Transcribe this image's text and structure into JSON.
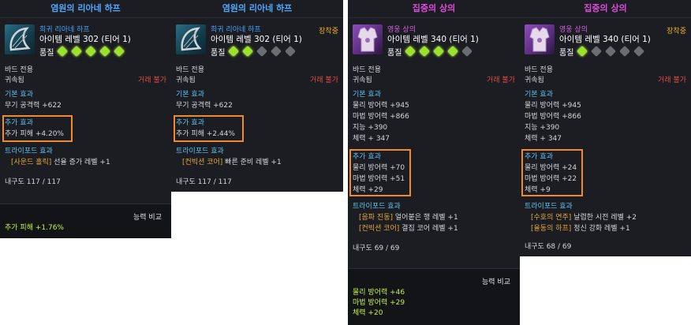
{
  "cards": [
    {
      "title": "염원의 리아네 하프",
      "grade": "희귀 리아네 하프",
      "level": "아이템 레벨 302 (티어 1)",
      "quality_label": "품질",
      "quality_stars_lit": 5,
      "quality_stars_total": 5,
      "bound_class": "바드 전용",
      "bound": "귀속됨",
      "untradable": "거래 불가",
      "base_title": "기본 효과",
      "base_stats": [
        "무기 공격력 +622"
      ],
      "extra_title": "추가 효과",
      "extra_stats": [
        "추가 피해 +4.20%"
      ],
      "tripod_title": "트라이포드 효과",
      "tripods": [
        {
          "name": "[사운드 홀릭]",
          "desc": "선율 증가 레벨 +1"
        }
      ],
      "durability": "내구도 117 / 117",
      "compare_title": "능력 비교",
      "compare_stats": [
        "추가 피해 +1.76%"
      ]
    },
    {
      "title": "염원의 리아네 하프",
      "grade": "희귀 리아네 하프",
      "equipped": "장착중",
      "level": "아이템 레벨 302 (티어 1)",
      "quality_label": "품질",
      "quality_stars_lit": 2,
      "quality_stars_total": 5,
      "bound_class": "바드 전용",
      "bound": "귀속됨",
      "untradable": "거래 불가",
      "base_title": "기본 효과",
      "base_stats": [
        "무기 공격력 +622"
      ],
      "extra_title": "추가 효과",
      "extra_stats": [
        "추가 피해 +2.44%"
      ],
      "tripod_title": "트라이포드 효과",
      "tripods": [
        {
          "name": "[컨빅션 코어]",
          "desc": "빠른 준비 레벨 +1"
        }
      ],
      "durability": "내구도 117 / 117"
    },
    {
      "title": "집중의 상의",
      "grade": "영웅 상의",
      "level": "아이템 레벨 340 (티어 1)",
      "quality_label": "품질",
      "quality_stars_lit": 4,
      "quality_stars_total": 5,
      "bound_class": "바드 전용",
      "bound": "귀속됨",
      "untradable": "거래 불가",
      "base_title": "기본 효과",
      "base_stats": [
        "물리 방어력 +945",
        "마법 방어력 +866",
        "지능 +390",
        "체력 + 347"
      ],
      "extra_title": "추가 효과",
      "extra_stats": [
        "물리 방어력 +70",
        "마법 방어력 +51",
        "체력 +29"
      ],
      "tripod_title": "트라이포드 효과",
      "tripods": [
        {
          "name": "[음파 진동]",
          "desc": "얼어붙은 행 레벨 +1"
        },
        {
          "name": "[컨빅션 코어]",
          "desc": "결집 코어 레벨 +1"
        }
      ],
      "durability": "내구도 69 / 69",
      "compare_title": "능력 비교",
      "compare_stats": [
        "물리 방어력 +46",
        "마법 방어력 +29",
        "체력 +20"
      ]
    },
    {
      "title": "집중의 상의",
      "grade": "영웅 상의",
      "equipped": "장착중",
      "level": "아이템 레벨 340 (티어 1)",
      "quality_label": "품질",
      "quality_stars_lit": 1,
      "quality_stars_total": 5,
      "bound_class": "바드 전용",
      "bound": "귀속됨",
      "untradable": "거래 불가",
      "base_title": "기본 효과",
      "base_stats": [
        "물리 방어력 +945",
        "마법 방어력 +866",
        "지능 +390",
        "체력 + 347"
      ],
      "extra_title": "추가 효과",
      "extra_stats": [
        "물리 방어력 +24",
        "마법 방어력 +22",
        "체력 +9"
      ],
      "tripod_title": "트라이포드 효과",
      "tripods": [
        {
          "name": "[수호의 연주]",
          "desc": "날렵한 시전 레벨 +2"
        },
        {
          "name": "[율동의 하프]",
          "desc": "정신 강화 레벨 +1"
        }
      ],
      "durability": "내구도 68 / 69"
    }
  ],
  "colors": {
    "highlight": "#f08a2c",
    "harp_title": "#4fa7ff",
    "robe_title": "#e14be0",
    "equipped": "#f0b020"
  }
}
